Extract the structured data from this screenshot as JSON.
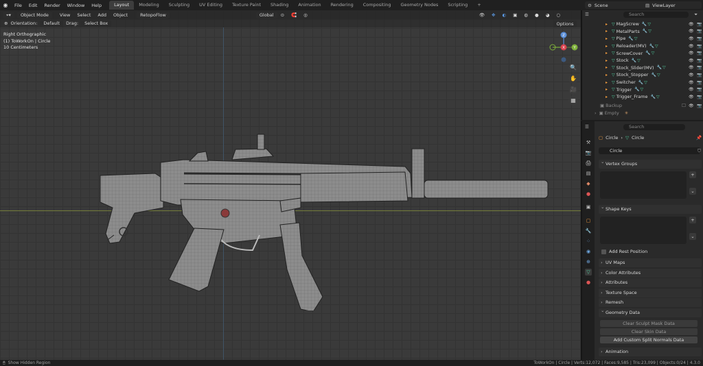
{
  "menu": [
    "File",
    "Edit",
    "Render",
    "Window",
    "Help"
  ],
  "workspaces": [
    "Layout",
    "Modeling",
    "Sculpting",
    "UV Editing",
    "Texture Paint",
    "Shading",
    "Animation",
    "Rendering",
    "Compositing",
    "Geometry Nodes",
    "Scripting"
  ],
  "active_workspace": "Layout",
  "workspace_add": "+",
  "scene": "Scene",
  "view_layer": "ViewLayer",
  "viewport": {
    "mode": "Object Mode",
    "menus": [
      "View",
      "Select",
      "Add",
      "Object"
    ],
    "addon_menu": "RetopoFlow",
    "orientation_label": "Orientation:",
    "orientation": "Default",
    "drag_label": "Drag:",
    "drag": "Select Box",
    "transform": "Global",
    "options": "Options",
    "info_view": "Right Orthographic",
    "info_object": "(1) ToWorkOn | Circle",
    "info_scale": "10 Centimeters",
    "gizmo": {
      "x": "X",
      "y": "Y",
      "z": "Z"
    }
  },
  "outliner": {
    "search_placeholder": "Search",
    "items": [
      "MagScrew",
      "MetalParts",
      "Pipe",
      "Reloader(MV)",
      "ScrewCover",
      "Stock",
      "Stock_Slider(MV)",
      "Stock_Stopper",
      "Switcher",
      "Trigger",
      "Trigger_Frame"
    ],
    "collections": [
      "Backup",
      "Empty"
    ]
  },
  "properties": {
    "search_placeholder": "Search",
    "breadcrumb": [
      "Circle",
      "Circle"
    ],
    "mesh_name": "Circle",
    "panels": {
      "vertex_groups": "Vertex Groups",
      "shape_keys": "Shape Keys",
      "add_rest_position": "Add Rest Position",
      "uv_maps": "UV Maps",
      "color_attributes": "Color Attributes",
      "attributes": "Attributes",
      "texture_space": "Texture Space",
      "remesh": "Remesh",
      "geometry_data": "Geometry Data",
      "animation": "Animation"
    },
    "buttons": {
      "clear_sculpt": "Clear Sculpt Mask Data",
      "clear_skin": "Clear Skin Data",
      "add_split_normals": "Add Custom Split Normals Data"
    }
  },
  "status": {
    "left": "Show Hidden Region",
    "right": "ToWorkOn | Circle | Verts:12,072 | Faces:9,585 | Tris:23,099 | Objects:0/24 | 4.3.0"
  }
}
